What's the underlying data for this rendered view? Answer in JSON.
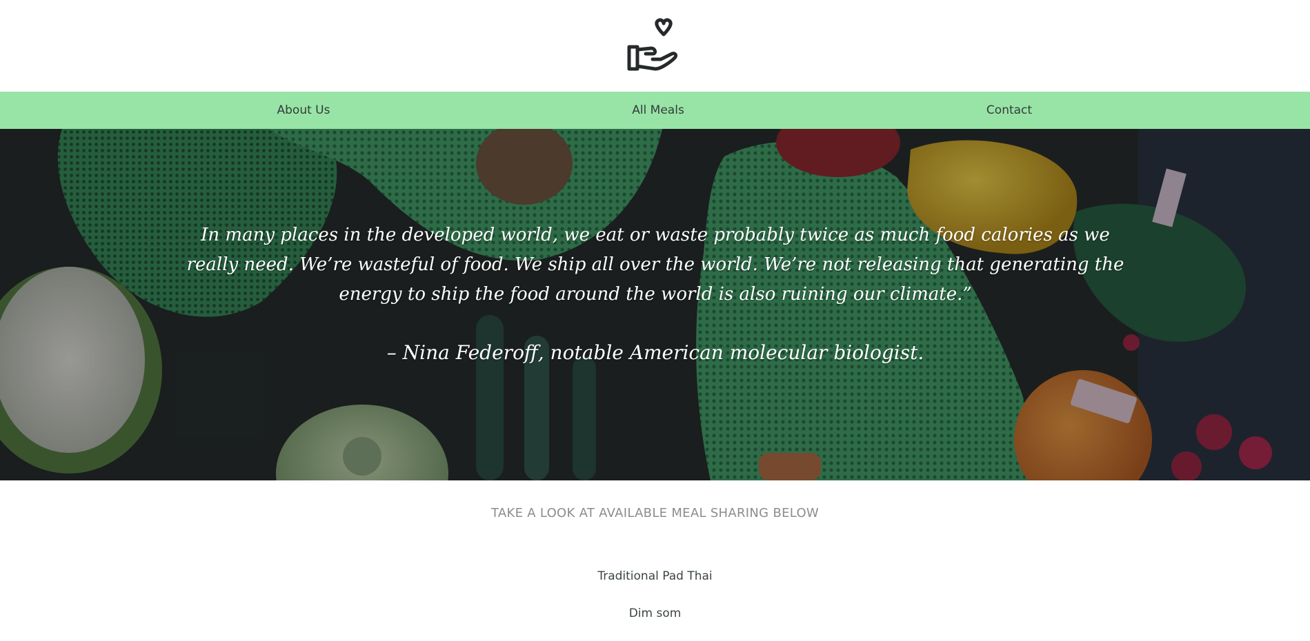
{
  "logo": {
    "icon": "hand-heart-icon",
    "stroke_color": "#262a2a"
  },
  "nav": {
    "background_color": "#98e4a6",
    "items": [
      {
        "label": "About Us"
      },
      {
        "label": "All Meals"
      },
      {
        "label": "Contact"
      }
    ]
  },
  "hero": {
    "quote": "In many places in the developed world, we eat or waste probably twice as much food calories as we really need. We’re wasteful of food. We ship all over the world. We’re not releasing that generating the energy to ship the food around the world is also ruining our climate.”",
    "author": "– Nina Federoff, notable American molecular biologist."
  },
  "section": {
    "title": "TAKE A LOOK AT AVAILABLE MEAL SHARING BELOW"
  },
  "meals": [
    {
      "name": "Traditional Pad Thai"
    },
    {
      "name": "Dim som"
    }
  ]
}
